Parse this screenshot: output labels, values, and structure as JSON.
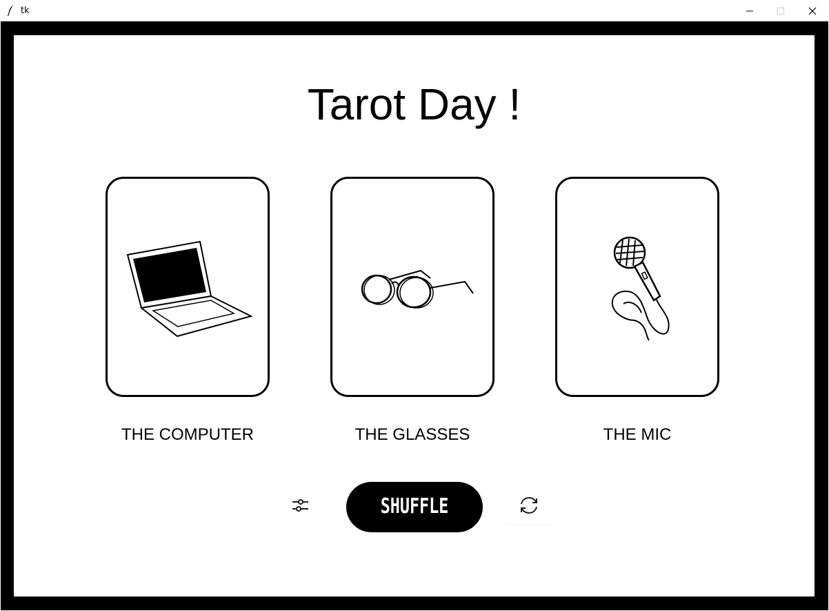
{
  "window": {
    "title": "tk",
    "controls": [
      "minimize-icon",
      "maximize-icon",
      "close-icon"
    ]
  },
  "app": {
    "heading": "Tarot Day !",
    "cards": [
      {
        "label": "THE COMPUTER",
        "icon": "laptop-icon"
      },
      {
        "label": "THE GLASSES",
        "icon": "glasses-icon"
      },
      {
        "label": "THE MIC",
        "icon": "microphone-icon"
      }
    ],
    "controls": {
      "settings_icon": "sliders-icon",
      "shuffle_label": "SHUFFLE",
      "refresh_icon": "refresh-icon"
    }
  },
  "colors": {
    "background": "#ffffff",
    "frame": "#000000",
    "button": "#000000",
    "button_text": "#ffffff"
  }
}
